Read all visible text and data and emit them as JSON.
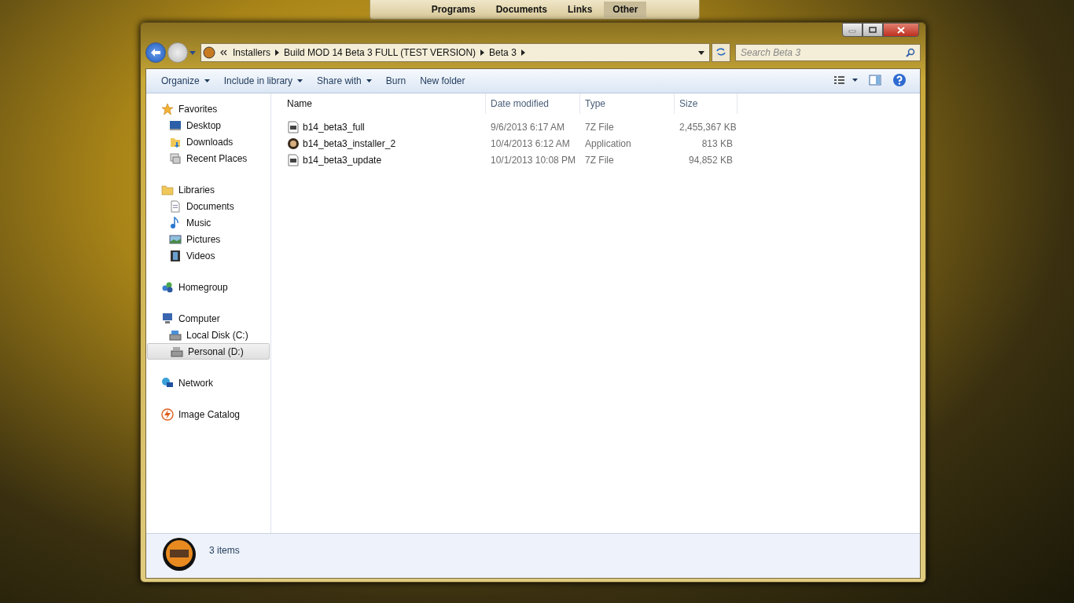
{
  "top_menu": [
    {
      "label": "Programs",
      "selected": false
    },
    {
      "label": "Documents",
      "selected": false
    },
    {
      "label": "Links",
      "selected": false
    },
    {
      "label": "Other",
      "selected": true
    }
  ],
  "breadcrumb": [
    "Installers",
    "Build MOD 14 Beta 3 FULL (TEST VERSION)",
    "Beta 3"
  ],
  "search": {
    "placeholder": "Search Beta 3"
  },
  "toolbar": [
    {
      "label": "Organize",
      "dropdown": true
    },
    {
      "label": "Include in library",
      "dropdown": true
    },
    {
      "label": "Share with",
      "dropdown": true
    },
    {
      "label": "Burn",
      "dropdown": false
    },
    {
      "label": "New folder",
      "dropdown": false
    }
  ],
  "sidebar": {
    "groups": [
      {
        "label": "Favorites",
        "kind": "star",
        "selected": false,
        "children": [
          {
            "label": "Desktop",
            "kind": "monitor",
            "selected": false
          },
          {
            "label": "Downloads",
            "kind": "folder",
            "selected": false
          },
          {
            "label": "Recent Places",
            "kind": "recent",
            "selected": false
          }
        ]
      },
      {
        "label": "Libraries",
        "kind": "folder",
        "selected": false,
        "children": [
          {
            "label": "Documents",
            "kind": "document",
            "selected": false
          },
          {
            "label": "Music",
            "kind": "note",
            "selected": false
          },
          {
            "label": "Pictures",
            "kind": "picture",
            "selected": false
          },
          {
            "label": "Videos",
            "kind": "film",
            "selected": false
          }
        ]
      },
      {
        "label": "Homegroup",
        "kind": "homegroup",
        "selected": false
      },
      {
        "label": "Computer",
        "kind": "monitor",
        "selected": false,
        "children": [
          {
            "label": "Local Disk (C:)",
            "kind": "drive",
            "selected": false
          },
          {
            "label": "Personal (D:)",
            "kind": "drive",
            "selected": true
          }
        ]
      },
      {
        "label": "Network",
        "kind": "globe",
        "selected": false
      },
      {
        "label": "Image Catalog",
        "kind": "bolt",
        "selected": false
      }
    ]
  },
  "table": {
    "columns": [
      "Name",
      "Date modified",
      "Type",
      "Size"
    ],
    "rows": [
      {
        "name": "b14_beta3_full",
        "date": "9/6/2013 6:17 AM",
        "type": "7Z File",
        "size": "2,455,367 KB",
        "kind": "archive"
      },
      {
        "name": "b14_beta3_installer_2",
        "date": "10/4/2013 6:12 AM",
        "type": "Application",
        "size": "813 KB",
        "kind": "application"
      },
      {
        "name": "b14_beta3_update",
        "date": "10/1/2013 10:08 PM",
        "type": "7Z File",
        "size": "94,852 KB",
        "kind": "archive"
      }
    ]
  },
  "status_bar": {
    "count": "3 items"
  }
}
